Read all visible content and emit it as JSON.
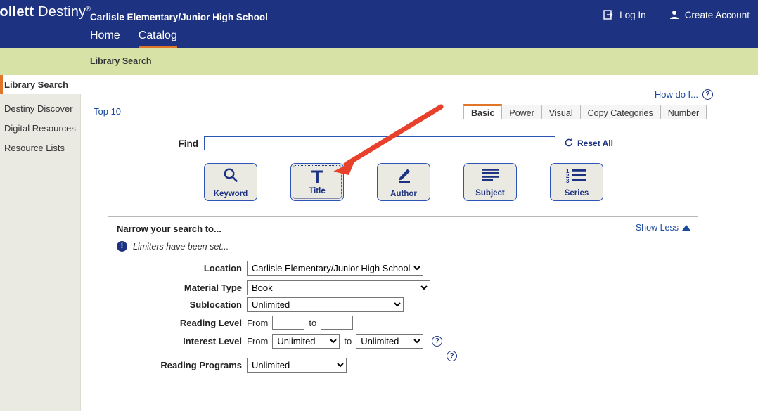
{
  "header": {
    "logo_main": "Follett",
    "logo_sub": "Destiny",
    "logo_reg": "®",
    "school_name": "Carlisle Elementary/Junior High School",
    "nav": [
      {
        "label": "Home",
        "active": false
      },
      {
        "label": "Catalog",
        "active": true
      }
    ],
    "account": [
      {
        "label": "Log In",
        "icon": "login-icon"
      },
      {
        "label": "Create Account",
        "icon": "person-icon"
      }
    ],
    "accent_color": "#e0762a",
    "bar_color": "#1d3281"
  },
  "subheader": {
    "title": "Library Search",
    "band_color": "#d6e2a6"
  },
  "sidebar": {
    "items": [
      {
        "label": "Library Search",
        "active": true
      },
      {
        "label": "Destiny Discover",
        "active": false
      },
      {
        "label": "Digital Resources",
        "active": false
      },
      {
        "label": "Resource Lists",
        "active": false
      }
    ]
  },
  "main": {
    "how_do_i": "How do I...",
    "help_glyph": "?",
    "top10": "Top 10",
    "tabs": [
      {
        "label": "Basic",
        "active": true
      },
      {
        "label": "Power",
        "active": false
      },
      {
        "label": "Visual",
        "active": false
      },
      {
        "label": "Copy Categories",
        "active": false
      },
      {
        "label": "Number",
        "active": false
      }
    ],
    "find": {
      "label": "Find",
      "value": "",
      "placeholder": ""
    },
    "reset_all": "Reset All",
    "search_types": [
      {
        "label": "Keyword",
        "icon": "magnifier-icon",
        "selected": false
      },
      {
        "label": "Title",
        "icon": "letter-t-icon",
        "selected": true
      },
      {
        "label": "Author",
        "icon": "pencil-icon",
        "selected": false
      },
      {
        "label": "Subject",
        "icon": "lines-icon",
        "selected": false
      },
      {
        "label": "Series",
        "icon": "numbered-list-icon",
        "selected": false
      }
    ],
    "narrow": {
      "title": "Narrow your search to...",
      "show_less": "Show Less",
      "limiters_notice": "Limiters have been set...",
      "location": {
        "label": "Location",
        "value": "Carlisle Elementary/Junior High School"
      },
      "material_type": {
        "label": "Material Type",
        "value": "Book"
      },
      "sublocation": {
        "label": "Sublocation",
        "value": "Unlimited"
      },
      "reading_level": {
        "label": "Reading Level",
        "from_label": "From",
        "from_value": "",
        "to_label": "to",
        "to_value": ""
      },
      "interest_level": {
        "label": "Interest Level",
        "from_label": "From",
        "from_value": "Unlimited",
        "to_label": "to",
        "to_value": "Unlimited",
        "help_glyph": "?"
      },
      "reading_programs": {
        "label": "Reading Programs",
        "value": "Unlimited",
        "help_glyph": "?"
      }
    }
  },
  "annotation": {
    "arrow_color": "#e8402a",
    "points_to": "Title"
  }
}
